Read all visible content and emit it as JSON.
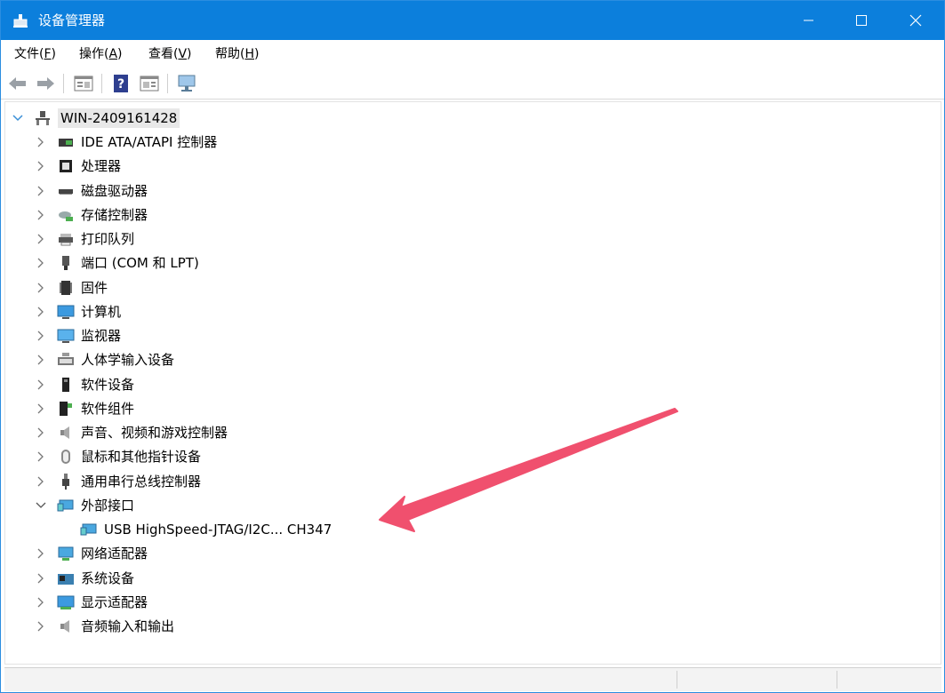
{
  "window": {
    "title": "设备管理器"
  },
  "menu": {
    "items": [
      {
        "text": "文件(",
        "key": "F",
        "end": ")"
      },
      {
        "text": "操作(",
        "key": "A",
        "end": ")"
      },
      {
        "text": "查看(",
        "key": "V",
        "end": ")"
      },
      {
        "text": "帮助(",
        "key": "H",
        "end": ")"
      }
    ]
  },
  "tree": {
    "root": "WIN-2409161428",
    "categories": [
      {
        "label": "IDE ATA/ATAPI 控制器",
        "icon": "ide-controller-icon"
      },
      {
        "label": "处理器",
        "icon": "processor-icon"
      },
      {
        "label": "磁盘驱动器",
        "icon": "disk-drive-icon"
      },
      {
        "label": "存储控制器",
        "icon": "storage-controller-icon"
      },
      {
        "label": "打印队列",
        "icon": "printer-icon"
      },
      {
        "label": "端口 (COM 和 LPT)",
        "icon": "port-icon"
      },
      {
        "label": "固件",
        "icon": "firmware-icon"
      },
      {
        "label": "计算机",
        "icon": "computer-icon"
      },
      {
        "label": "监视器",
        "icon": "monitor-icon"
      },
      {
        "label": "人体学输入设备",
        "icon": "hid-icon"
      },
      {
        "label": "软件设备",
        "icon": "software-device-icon"
      },
      {
        "label": "软件组件",
        "icon": "software-component-icon"
      },
      {
        "label": "声音、视频和游戏控制器",
        "icon": "audio-icon"
      },
      {
        "label": "鼠标和其他指针设备",
        "icon": "mouse-icon"
      },
      {
        "label": "通用串行总线控制器",
        "icon": "usb-icon"
      },
      {
        "label": "外部接口",
        "icon": "external-interface-icon",
        "expanded": true
      },
      {
        "label": "网络适配器",
        "icon": "network-adapter-icon"
      },
      {
        "label": "系统设备",
        "icon": "system-device-icon"
      },
      {
        "label": "显示适配器",
        "icon": "display-adapter-icon"
      },
      {
        "label": "音频输入和输出",
        "icon": "audio-io-icon"
      }
    ],
    "child": {
      "label": "USB HighSpeed-JTAG/I2C... CH347",
      "icon": "external-interface-icon"
    }
  },
  "colors": {
    "titlebar": "#0c7fdc",
    "arrow": "#f0506e"
  }
}
